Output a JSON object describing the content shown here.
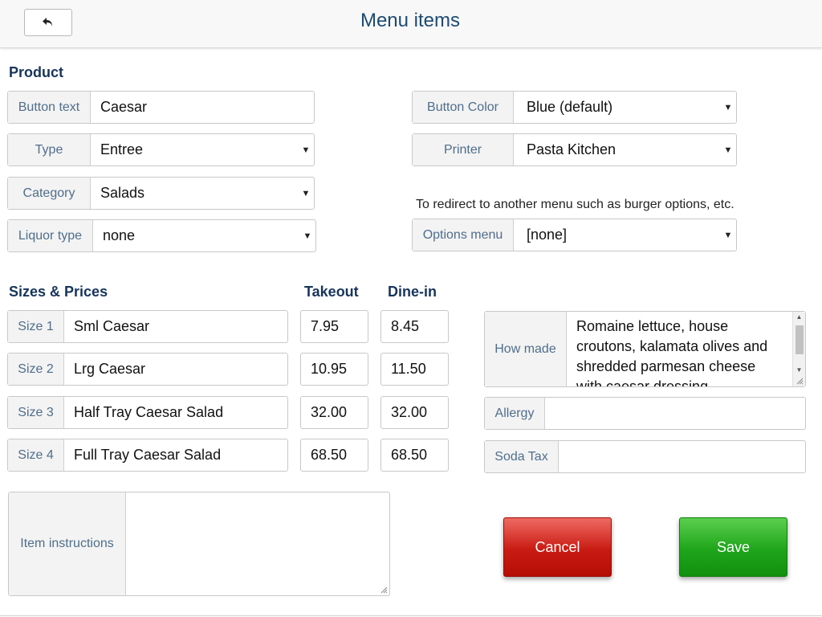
{
  "header": {
    "title": "Menu items",
    "back_icon": "undo-arrow-icon"
  },
  "product": {
    "section_title": "Product",
    "button_text": {
      "label": "Button text",
      "value": "Caesar"
    },
    "type": {
      "label": "Type",
      "value": "Entree"
    },
    "category": {
      "label": "Category",
      "value": "Salads"
    },
    "liquor_type": {
      "label": "Liquor type",
      "value": "none"
    },
    "button_color": {
      "label": "Button Color",
      "value": "Blue (default)"
    },
    "printer": {
      "label": "Printer",
      "value": "Pasta Kitchen"
    },
    "options_note": "To redirect to another menu such as burger options, etc.",
    "options_menu": {
      "label": "Options menu",
      "value": "[none]"
    }
  },
  "sizes": {
    "section_title": "Sizes & Prices",
    "takeout_header": "Takeout",
    "dinein_header": "Dine-in",
    "rows": [
      {
        "label": "Size 1",
        "name": "Sml Caesar",
        "takeout": "7.95",
        "dinein": "8.45"
      },
      {
        "label": "Size 2",
        "name": "Lrg Caesar",
        "takeout": "10.95",
        "dinein": "11.50"
      },
      {
        "label": "Size 3",
        "name": "Half Tray Caesar Salad",
        "takeout": "32.00",
        "dinein": "32.00"
      },
      {
        "label": "Size 4",
        "name": "Full Tray Caesar Salad",
        "takeout": "68.50",
        "dinein": "68.50"
      }
    ]
  },
  "details": {
    "how_made": {
      "label": "How made",
      "value": "Romaine lettuce, house croutons, kalamata olives and shredded parmesan cheese with caesar dressing"
    },
    "allergy": {
      "label": "Allergy",
      "value": ""
    },
    "soda_tax": {
      "label": "Soda Tax",
      "value": ""
    },
    "item_instructions": {
      "label": "Item instructions",
      "value": ""
    }
  },
  "actions": {
    "cancel_label": "Cancel",
    "save_label": "Save"
  },
  "colors": {
    "title": "#1d4a72",
    "section": "#17355c",
    "label": "#4f6e8c",
    "cancel": "#c81b12",
    "save": "#1ea51a"
  }
}
